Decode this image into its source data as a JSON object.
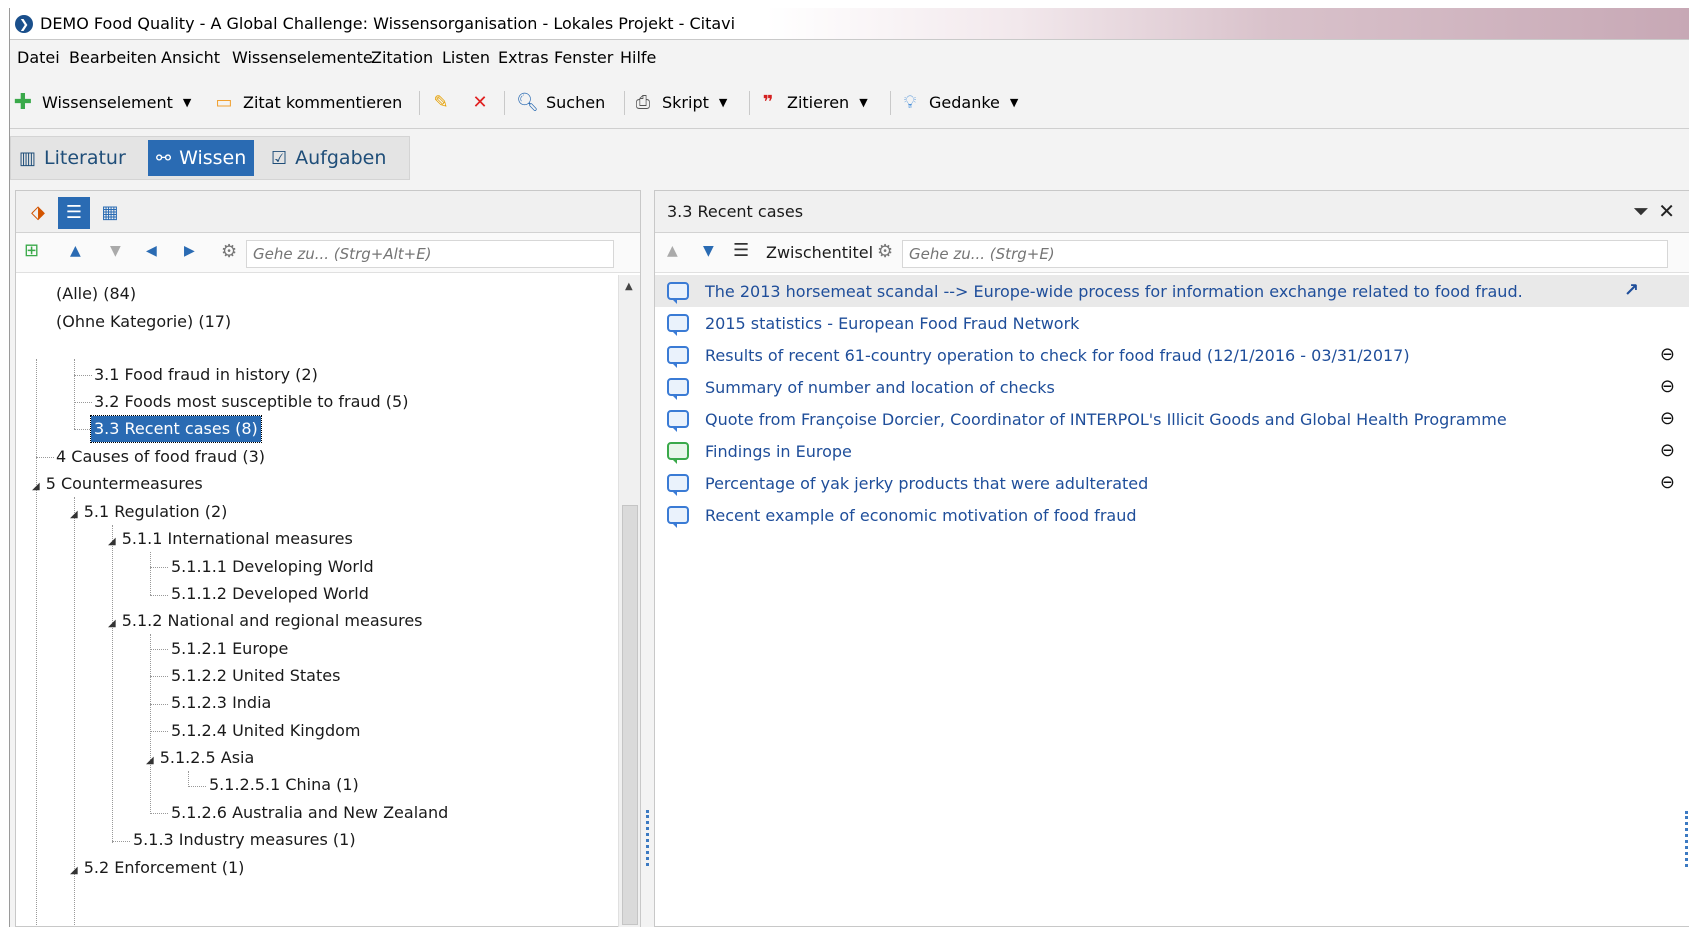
{
  "window": {
    "title": "DEMO Food Quality - A Global Challenge: Wissensorganisation - Lokales Projekt - Citavi"
  },
  "menu": [
    "Datei",
    "Bearbeiten",
    "Ansicht",
    "Wissenselemente",
    "Zitation",
    "Listen",
    "Extras",
    "Fenster",
    "Hilfe"
  ],
  "toolbar": {
    "knowledge_item": "Wissenselement",
    "comment_quote": "Zitat kommentieren",
    "search": "Suchen",
    "script": "Skript",
    "cite": "Zitieren",
    "thought": "Gedanke"
  },
  "views": {
    "literature": "Literatur",
    "knowledge": "Wissen",
    "tasks": "Aufgaben"
  },
  "left": {
    "goto_placeholder": "Gehe zu... (Strg+Alt+E)",
    "tree": [
      "(Alle) (84)",
      "(Ohne Kategorie) (17)",
      "3.1 Food fraud in history (2)",
      "3.2 Foods most susceptible to fraud (5)",
      "3.3 Recent cases (8)",
      "4 Causes of food fraud (3)",
      "5 Countermeasures",
      "5.1 Regulation (2)",
      "5.1.1 International measures",
      "5.1.1.1 Developing World",
      "5.1.1.2 Developed World",
      "5.1.2 National and regional measures",
      "5.1.2.1 Europe",
      "5.1.2.2 United States",
      "5.1.2.3 India",
      "5.1.2.4 United Kingdom",
      "5.1.2.5 Asia",
      "5.1.2.5.1 China (1)",
      "5.1.2.6 Australia and New Zealand",
      "5.1.3 Industry measures (1)",
      "5.2 Enforcement (1)"
    ]
  },
  "right": {
    "title": "3.3 Recent cases",
    "subheading_label": "Zwischentitel",
    "goto_placeholder": "Gehe zu... (Strg+E)",
    "items": [
      "The 2013 horsemeat scandal --> Europe-wide process for information exchange related to food fraud.",
      "2015 statistics - European Food Fraud Network",
      "Results of recent 61-country operation to check for food fraud (12/1/2016 - 03/31/2017)",
      "Summary of number and location of checks",
      "Quote from Françoise Dorcier, Coordinator of INTERPOL's Illicit Goods and Global Health Programme",
      "Findings in Europe",
      "Percentage of yak jerky products that were adulterated",
      "Recent example of economic motivation of food fraud"
    ]
  }
}
